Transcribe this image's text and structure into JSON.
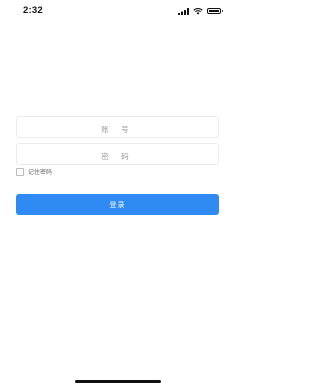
{
  "status_bar": {
    "time": "2:32",
    "icons": [
      "signal-icon",
      "wifi-icon",
      "battery-icon"
    ]
  },
  "login_form": {
    "account_placeholder": "账 号",
    "password_placeholder": "密 码",
    "remember_label": "记住密码",
    "remember_checked": false,
    "login_button_label": "登录"
  },
  "colors": {
    "primary": "#2f8bf3",
    "field_border": "#ececec",
    "placeholder": "#9b9b9b",
    "background": "#ffffff"
  }
}
